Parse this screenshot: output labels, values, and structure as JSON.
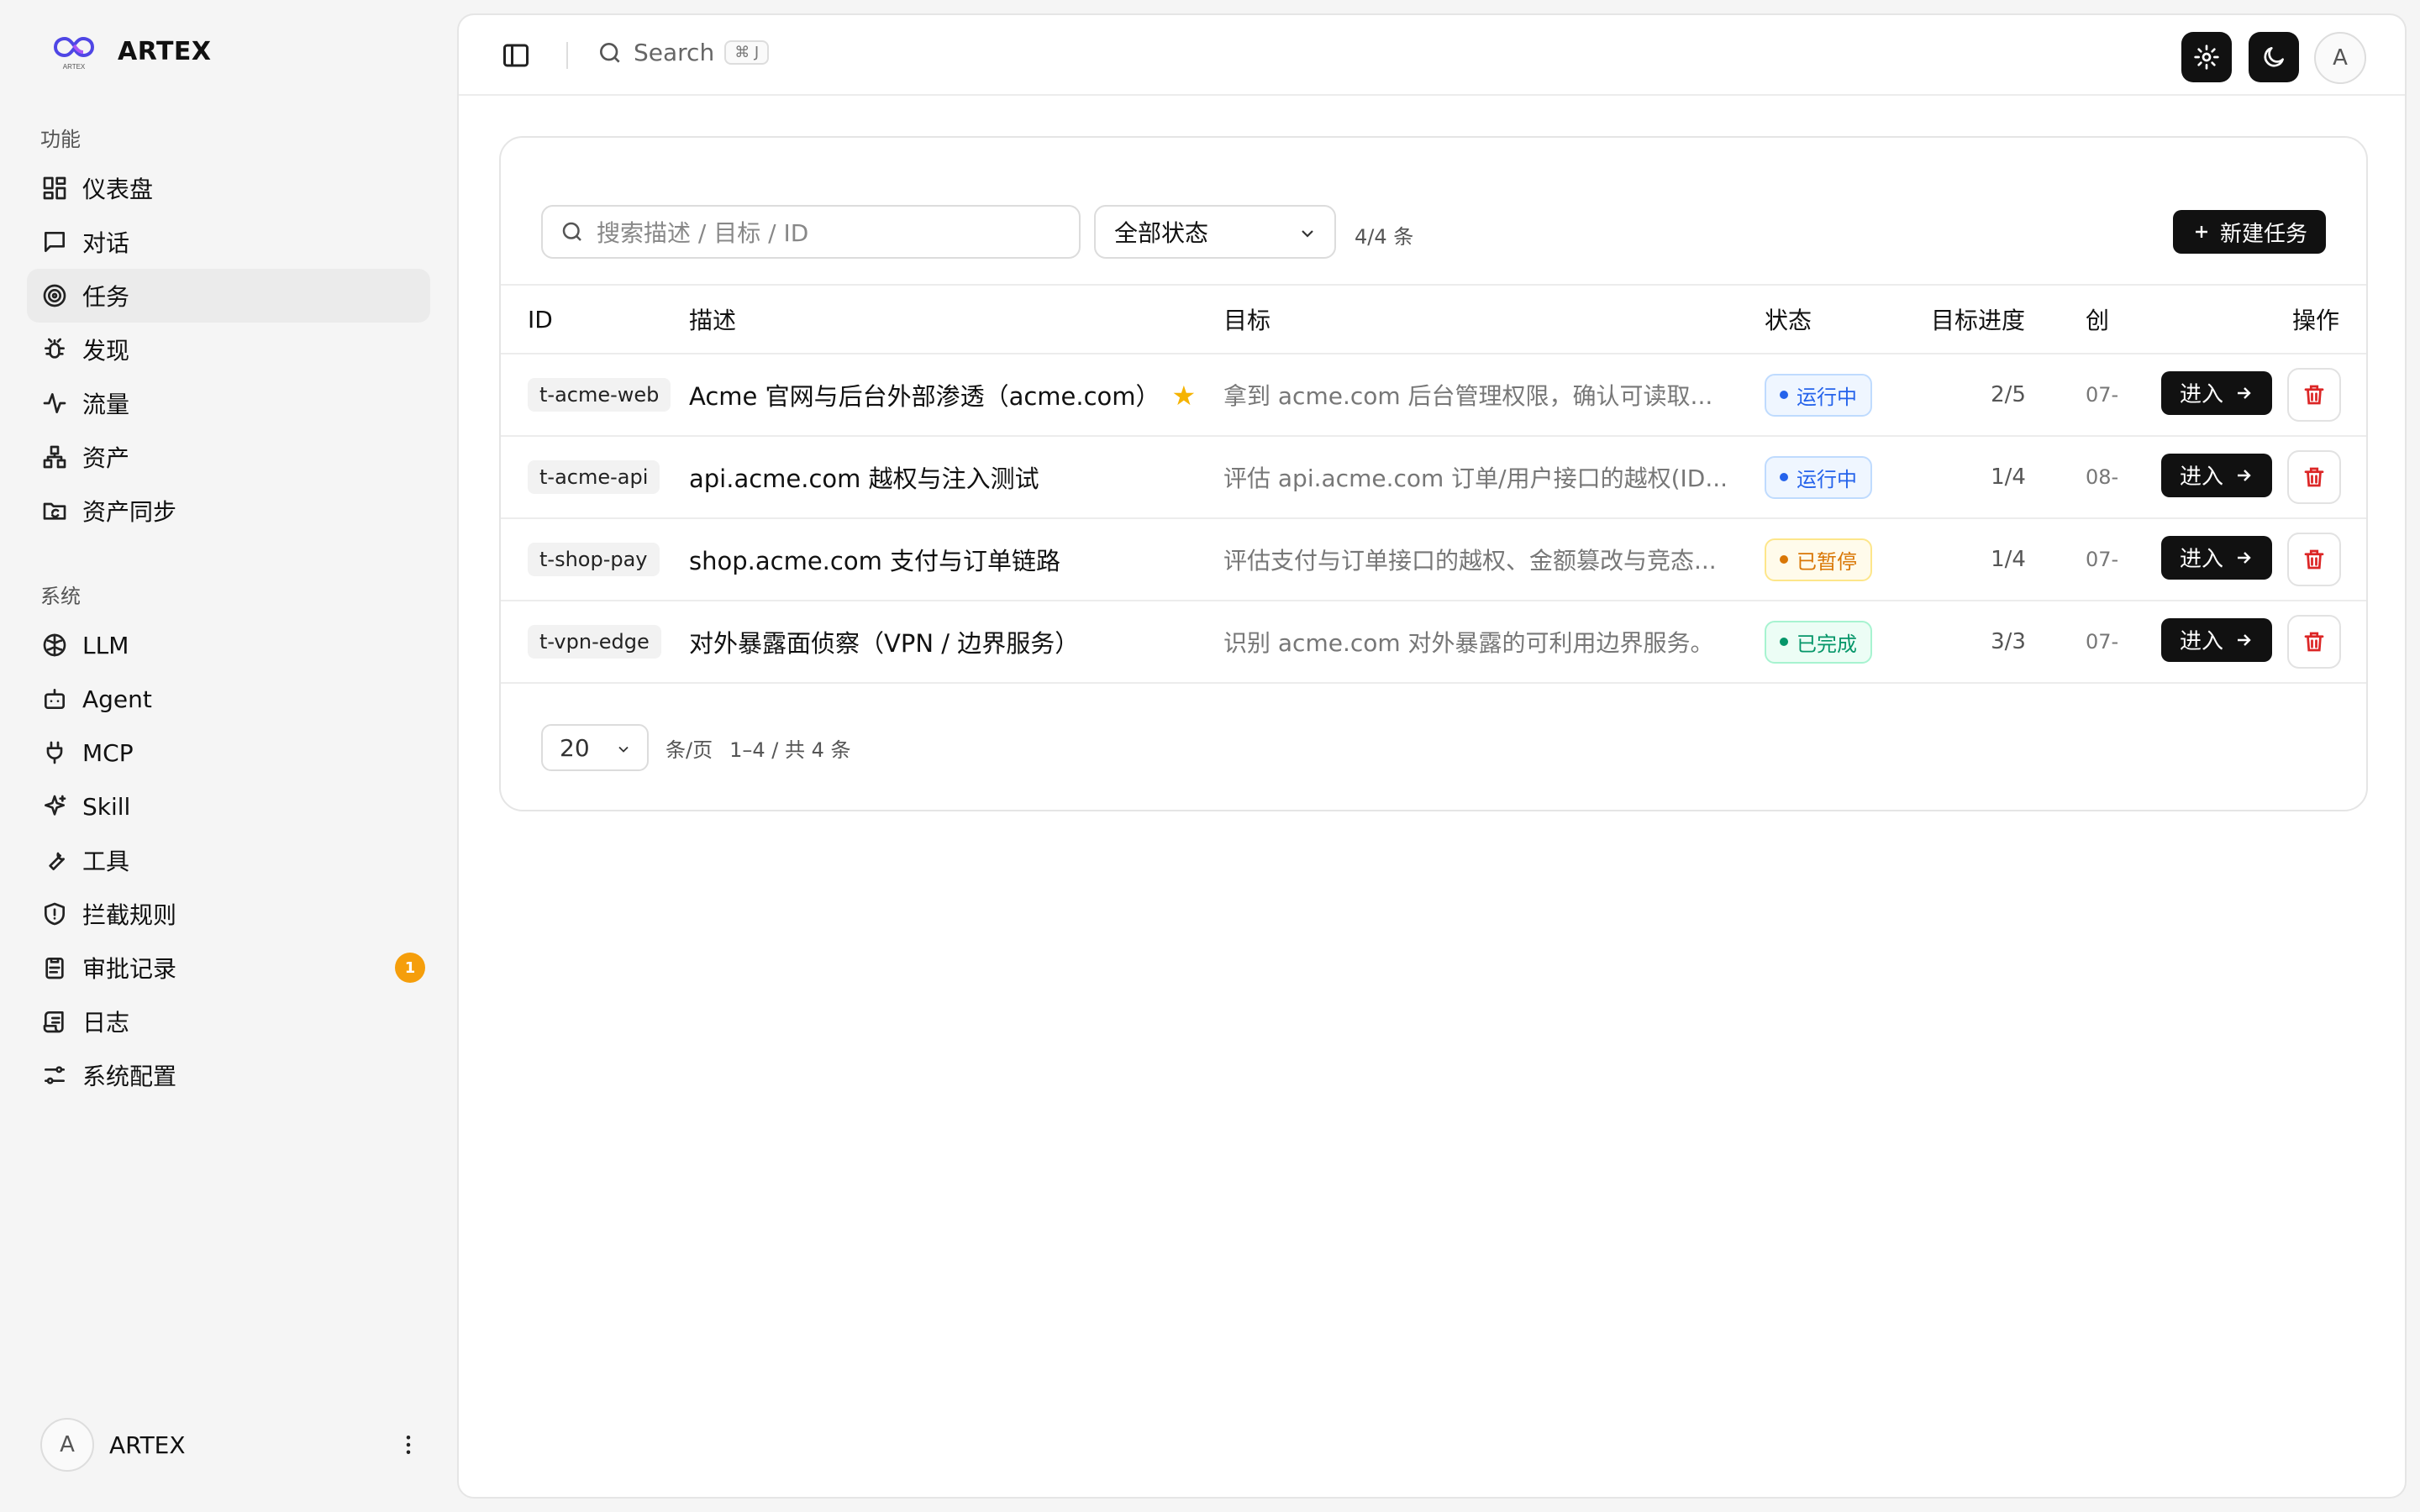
{
  "brand": {
    "name": "ARTEX",
    "logo_caption": "ARTEX"
  },
  "sidebar": {
    "section_features": "功能",
    "section_system": "系统",
    "items": [
      {
        "label": "仪表盘",
        "icon": "dashboard-icon"
      },
      {
        "label": "对话",
        "icon": "chat-icon"
      },
      {
        "label": "任务",
        "icon": "target-icon",
        "active": true
      },
      {
        "label": "发现",
        "icon": "bug-icon"
      },
      {
        "label": "流量",
        "icon": "activity-icon"
      },
      {
        "label": "资产",
        "icon": "network-icon"
      },
      {
        "label": "资产同步",
        "icon": "folder-sync-icon"
      },
      {
        "label": "LLM",
        "icon": "brain-icon"
      },
      {
        "label": "Agent",
        "icon": "bot-icon"
      },
      {
        "label": "MCP",
        "icon": "plug-icon"
      },
      {
        "label": "Skill",
        "icon": "sparkles-icon"
      },
      {
        "label": "工具",
        "icon": "wrench-icon"
      },
      {
        "label": "拦截规则",
        "icon": "shield-icon"
      },
      {
        "label": "审批记录",
        "icon": "clipboard-icon",
        "badge": "1"
      },
      {
        "label": "日志",
        "icon": "scroll-icon"
      },
      {
        "label": "系统配置",
        "icon": "sliders-icon"
      }
    ],
    "user": {
      "avatar": "A",
      "name": "ARTEX"
    }
  },
  "topbar": {
    "search_label": "Search",
    "search_shortcut": "⌘ J",
    "avatar": "A"
  },
  "toolbar": {
    "search_placeholder": "搜索描述 / 目标 / ID",
    "status_filter": "全部状态",
    "count": "4/4 条",
    "new_task_label": "新建任务"
  },
  "table": {
    "headers": {
      "id": "ID",
      "desc": "描述",
      "target": "目标",
      "status": "状态",
      "progress": "目标进度",
      "created": "创",
      "actions": "操作"
    },
    "rows": [
      {
        "id": "t-acme-web",
        "desc": "Acme 官网与后台外部渗透（acme.com）",
        "starred": true,
        "target": "拿到 acme.com 后台管理权限，确认可读取...",
        "status": "运行中",
        "status_kind": "running",
        "progress": "2/5",
        "created": "07-",
        "enter": "进入"
      },
      {
        "id": "t-acme-api",
        "desc": "api.acme.com 越权与注入测试",
        "starred": false,
        "target": "评估 api.acme.com 订单/用户接口的越权(ID...",
        "status": "运行中",
        "status_kind": "running",
        "progress": "1/4",
        "created": "08-",
        "enter": "进入"
      },
      {
        "id": "t-shop-pay",
        "desc": "shop.acme.com 支付与订单链路",
        "starred": false,
        "target": "评估支付与订单接口的越权、金额篡改与竞态...",
        "status": "已暂停",
        "status_kind": "paused",
        "progress": "1/4",
        "created": "07-",
        "enter": "进入"
      },
      {
        "id": "t-vpn-edge",
        "desc": "对外暴露面侦察（VPN / 边界服务）",
        "starred": false,
        "target": "识别 acme.com 对外暴露的可利用边界服务。",
        "status": "已完成",
        "status_kind": "done",
        "progress": "3/3",
        "created": "07-",
        "enter": "进入"
      }
    ]
  },
  "pagination": {
    "page_size": "20",
    "per_page_label": "条/页",
    "range": "1–4 / 共 4 条"
  },
  "colors": {
    "running": {
      "fg": "#2563eb",
      "bg": "#eff6ff",
      "border": "#bfdbfe"
    },
    "paused": {
      "fg": "#d97706",
      "bg": "#fffbeb",
      "border": "#fde68a"
    },
    "done": {
      "fg": "#059669",
      "bg": "#ecfdf5",
      "border": "#a7f3d0"
    },
    "badge": "#f59e0b",
    "delete": "#dc2626"
  }
}
